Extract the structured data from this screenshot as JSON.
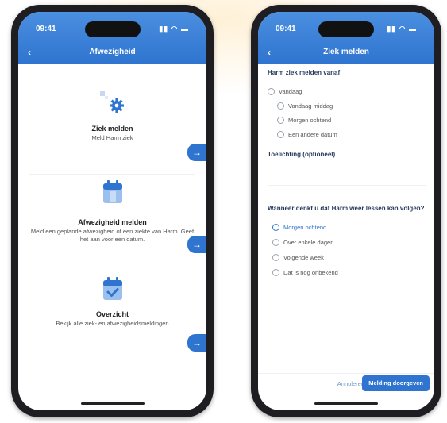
{
  "left_phone": {
    "status_time": "09:41",
    "status_icons": "▮▮ ◠ ▬",
    "back_icon": "‹",
    "title": "Afwezigheid",
    "cards": [
      {
        "title": "Ziek melden",
        "sub": "Meld Harm ziek"
      },
      {
        "title": "Afwezigheid melden",
        "sub": "Meld een geplande afwezigheid of een ziekte van Harm. Geef het aan voor een datum."
      },
      {
        "title": "Overzicht",
        "sub": "Bekijk alle ziek- en afwezigheidsmeldingen"
      }
    ],
    "go_icon": "→"
  },
  "right_phone": {
    "status_time": "09:41",
    "status_icons": "▮▮ ◠ ▬",
    "back_icon": "‹",
    "title": "Ziek melden",
    "question1": "Harm ziek melden vanaf",
    "options1": [
      "Vandaag",
      "Vandaag middag",
      "Morgen ochtend",
      "Een andere datum"
    ],
    "note_label": "Toelichting (optioneel)",
    "question2": "Wanneer denkt u dat Harm weer lessen kan volgen?",
    "options2": [
      "Morgen ochtend",
      "Over enkele dagen",
      "Volgende week",
      "Dat is nog onbekend"
    ],
    "cancel": "Annuleren",
    "submit": "Melding doorgeven"
  }
}
